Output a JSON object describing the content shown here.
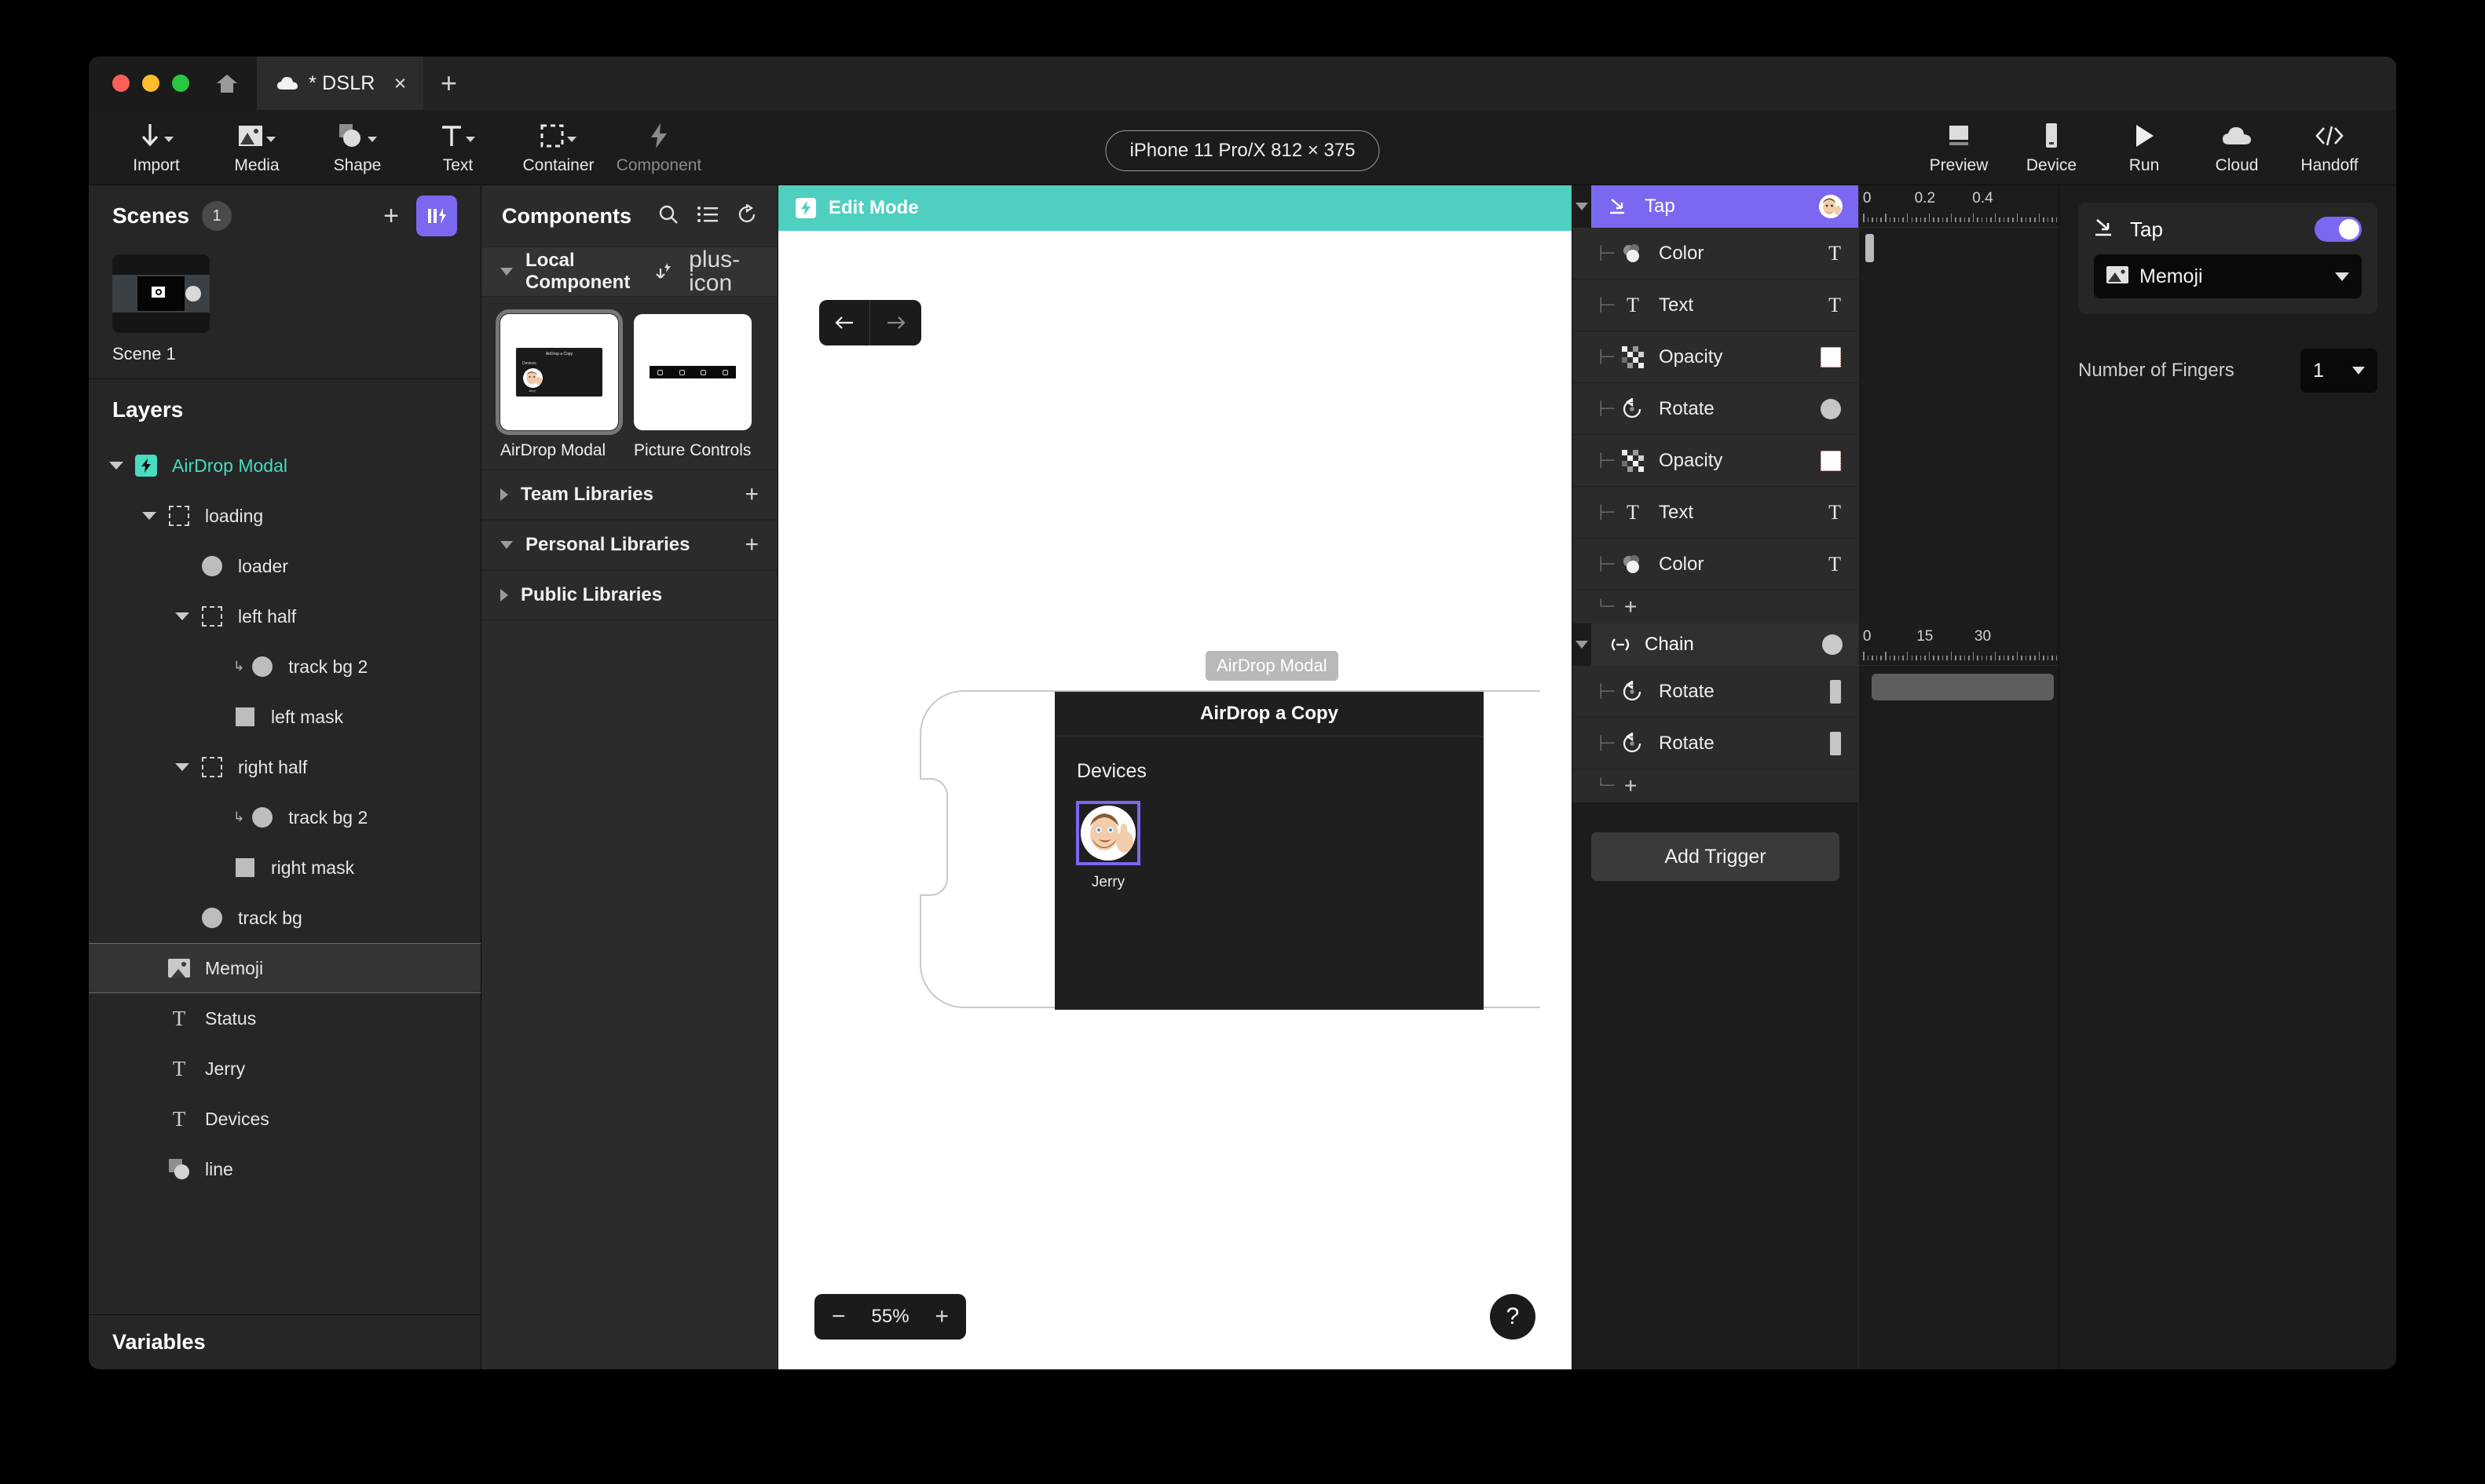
{
  "window": {
    "tab_title": "* DSLR",
    "tab_close": "×",
    "new_tab": "+"
  },
  "toolbar": {
    "items": [
      {
        "label": "Import",
        "icon": "download-arrow-icon",
        "disabled": false
      },
      {
        "label": "Media",
        "icon": "image-icon",
        "disabled": false
      },
      {
        "label": "Shape",
        "icon": "shape-icon",
        "disabled": false
      },
      {
        "label": "Text",
        "icon": "text-icon",
        "disabled": false
      },
      {
        "label": "Container",
        "icon": "container-icon",
        "disabled": false
      },
      {
        "label": "Component",
        "icon": "bolt-icon",
        "disabled": true
      }
    ],
    "device": "iPhone 11 Pro/X  812 × 375",
    "right_items": [
      {
        "label": "Preview",
        "icon": "preview-icon"
      },
      {
        "label": "Device",
        "icon": "device-icon"
      },
      {
        "label": "Run",
        "icon": "play-icon"
      },
      {
        "label": "Cloud",
        "icon": "cloud-icon"
      },
      {
        "label": "Handoff",
        "icon": "code-icon"
      }
    ]
  },
  "scenes": {
    "title": "Scenes",
    "count": "1",
    "add_label": "+",
    "items": [
      {
        "label": "Scene 1"
      }
    ]
  },
  "layers": {
    "title": "Layers",
    "variables_title": "Variables",
    "items": [
      {
        "name": "AirDrop Modal",
        "icon": "component-icon",
        "indent": 0,
        "expanded": true,
        "accent": true,
        "selected": false
      },
      {
        "name": "loading",
        "icon": "container-icon",
        "indent": 1,
        "expanded": true,
        "accent": false,
        "selected": false
      },
      {
        "name": "loader",
        "icon": "ellipse-icon",
        "indent": 2,
        "expanded": null,
        "accent": false,
        "selected": false
      },
      {
        "name": "left half",
        "icon": "container-icon",
        "indent": 2,
        "expanded": true,
        "accent": false,
        "selected": false
      },
      {
        "name": "track bg 2",
        "icon": "ellipse-icon",
        "indent": 3,
        "expanded": null,
        "accent": false,
        "selected": false,
        "linked": true
      },
      {
        "name": "left mask",
        "icon": "rect-icon",
        "indent": 3,
        "expanded": null,
        "accent": false,
        "selected": false
      },
      {
        "name": "right half",
        "icon": "container-icon",
        "indent": 2,
        "expanded": true,
        "accent": false,
        "selected": false
      },
      {
        "name": "track bg 2",
        "icon": "ellipse-icon",
        "indent": 3,
        "expanded": null,
        "accent": false,
        "selected": false,
        "linked": true
      },
      {
        "name": "right mask",
        "icon": "rect-icon",
        "indent": 3,
        "expanded": null,
        "accent": false,
        "selected": false
      },
      {
        "name": "track bg",
        "icon": "ellipse-icon",
        "indent": 2,
        "expanded": null,
        "accent": false,
        "selected": false
      },
      {
        "name": "Memoji",
        "icon": "image-icon",
        "indent": 1,
        "expanded": null,
        "accent": false,
        "selected": true
      },
      {
        "name": "Status",
        "icon": "text-icon",
        "indent": 1,
        "expanded": null,
        "accent": false,
        "selected": false
      },
      {
        "name": "Jerry",
        "icon": "text-icon",
        "indent": 1,
        "expanded": null,
        "accent": false,
        "selected": false
      },
      {
        "name": "Devices",
        "icon": "text-icon",
        "indent": 1,
        "expanded": null,
        "accent": false,
        "selected": false
      },
      {
        "name": "line",
        "icon": "shape-icon",
        "indent": 1,
        "expanded": null,
        "accent": false,
        "selected": false
      }
    ]
  },
  "components": {
    "title": "Components",
    "icons": [
      "search-icon",
      "list-icon",
      "refresh-icon"
    ],
    "local_section": {
      "title": "Local Component",
      "icons": [
        "upload-icon",
        "plus-icon"
      ],
      "expanded": true
    },
    "local_items": [
      {
        "name": "AirDrop Modal",
        "selected": true,
        "thumb": "modal"
      },
      {
        "name": "Picture Controls",
        "selected": false,
        "thumb": "bar"
      }
    ],
    "sections": [
      {
        "title": "Team Libraries",
        "expanded": false,
        "add": "+"
      },
      {
        "title": "Personal Libraries",
        "expanded": true,
        "add": "+"
      },
      {
        "title": "Public Libraries",
        "expanded": false,
        "add": ""
      }
    ]
  },
  "canvas": {
    "edit_mode_label": "Edit Mode",
    "nav_back": "←",
    "nav_forward": "→",
    "artboard_tag": "AirDrop Modal",
    "modal": {
      "title": "AirDrop a Copy",
      "devices_label": "Devices",
      "contact_name": "Jerry"
    },
    "zoom": {
      "minus": "−",
      "value": "55%",
      "plus": "+"
    },
    "help": "?"
  },
  "triggers": {
    "groups": [
      {
        "name": "Tap",
        "icon": "tap-icon",
        "style": "purple",
        "thumb": "memoji-avatar",
        "rows": [
          {
            "name": "Color",
            "icon": "color-icon",
            "swatch": "text"
          },
          {
            "name": "Text",
            "icon": "text-icon",
            "swatch": "text"
          },
          {
            "name": "Opacity",
            "icon": "opacity-icon",
            "swatch": "checker"
          },
          {
            "name": "Rotate",
            "icon": "rotate-icon",
            "swatch": "circle"
          },
          {
            "name": "Opacity",
            "icon": "opacity-icon",
            "swatch": "checker"
          },
          {
            "name": "Text",
            "icon": "text-icon",
            "swatch": "text"
          },
          {
            "name": "Color",
            "icon": "color-icon",
            "swatch": "text"
          }
        ],
        "add": "+",
        "ruler": {
          "labels": [
            "0",
            "0.2",
            "0.4"
          ],
          "positions": [
            4,
            33,
            62
          ]
        }
      },
      {
        "name": "Chain",
        "icon": "chain-icon",
        "style": "gray",
        "thumb": "circle",
        "rows": [
          {
            "name": "Rotate",
            "icon": "rotate-icon",
            "swatch": "bar"
          },
          {
            "name": "Rotate",
            "icon": "rotate-icon",
            "swatch": "bar"
          }
        ],
        "add": "+",
        "ruler": {
          "labels": [
            "0",
            "15",
            "30"
          ],
          "positions": [
            4,
            33,
            62
          ]
        }
      }
    ],
    "add_trigger_label": "Add Trigger"
  },
  "inspector": {
    "trigger_name": "Tap",
    "trigger_icon": "tap-icon",
    "target": "Memoji",
    "target_icon": "image-icon",
    "fingers_label": "Number of Fingers",
    "fingers_value": "1"
  },
  "colors": {
    "accent_purple": "#7b68f0",
    "accent_teal": "#4ecfc0",
    "panel_bg": "#262626",
    "canvas_bg": "#ffffff"
  }
}
